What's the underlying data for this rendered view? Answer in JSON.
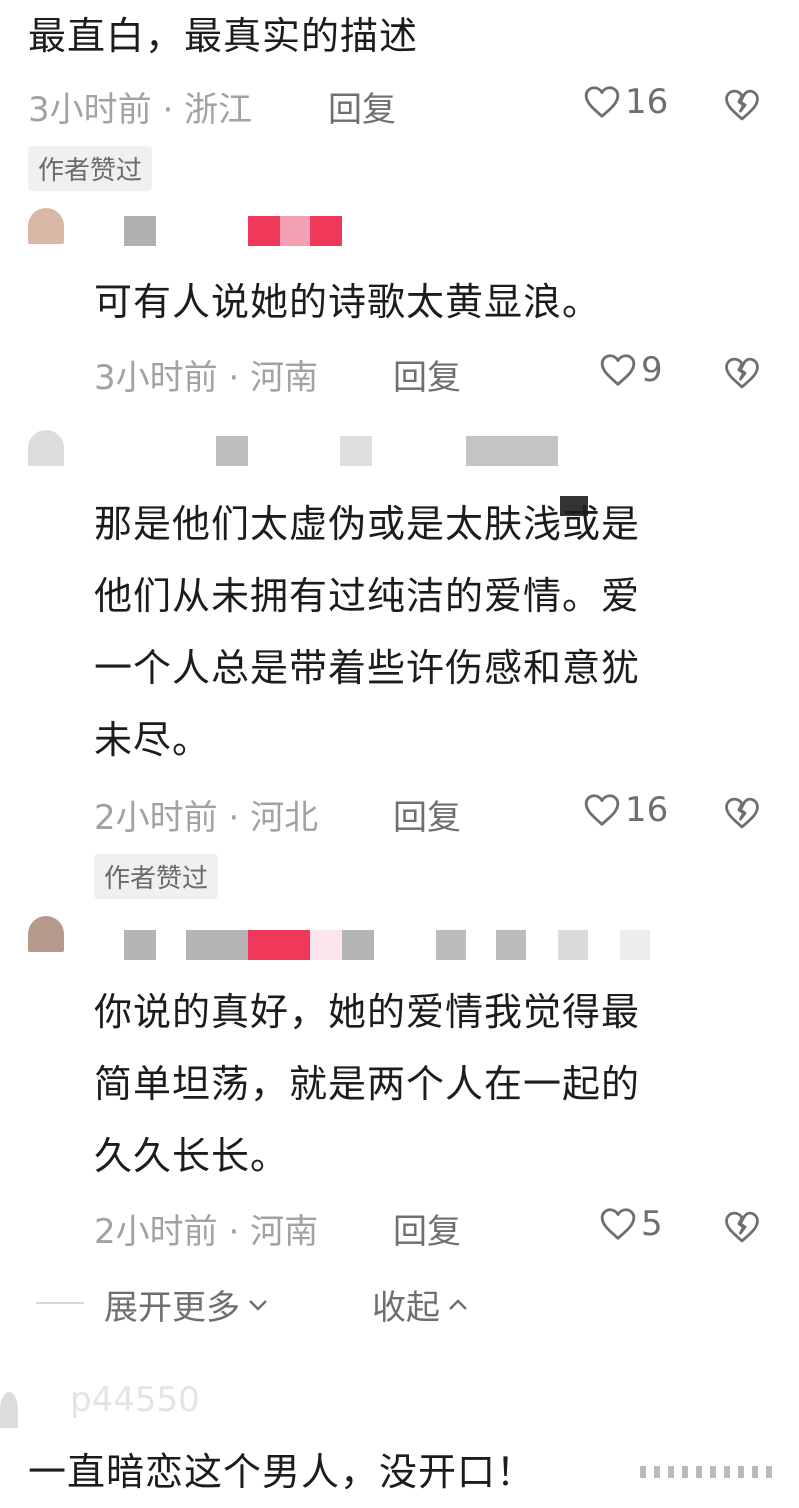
{
  "comments": [
    {
      "text": "最直白，最真实的描述",
      "time": "3小时前",
      "location": "浙江",
      "reply_label": "回复",
      "likes": "16",
      "badge": "作者赞过"
    },
    {
      "text": "可有人说她的诗歌太黄显浪。",
      "time": "3小时前",
      "location": "河南",
      "reply_label": "回复",
      "likes": "9"
    },
    {
      "lines": [
        "那是他们太虚伪或是太肤浅或是",
        "他们从未拥有过纯洁的爱情。爱",
        "一个人总是带着些许伤感和意犹",
        "未尽。"
      ],
      "time": "2小时前",
      "location": "河北",
      "reply_label": "回复",
      "likes": "16",
      "badge": "作者赞过"
    },
    {
      "lines": [
        "你说的真好，她的爱情我觉得最",
        "简单坦荡，就是两个人在一起的",
        "久久长长。"
      ],
      "time": "2小时前",
      "location": "河南",
      "reply_label": "回复",
      "likes": "5"
    }
  ],
  "controls": {
    "expand_more": "展开更多",
    "collapse": "收起"
  },
  "last_comment": {
    "username": "p44550",
    "text": "一直暗恋这个男人，没开口！"
  },
  "colors": {
    "meta": "#a2a2a2",
    "badge_bg": "#f0f0f0",
    "redaction_pink": "#f0385a"
  },
  "icons": [
    "heart-outline-icon",
    "broken-heart-icon",
    "chevron-down-icon",
    "chevron-up-icon"
  ]
}
